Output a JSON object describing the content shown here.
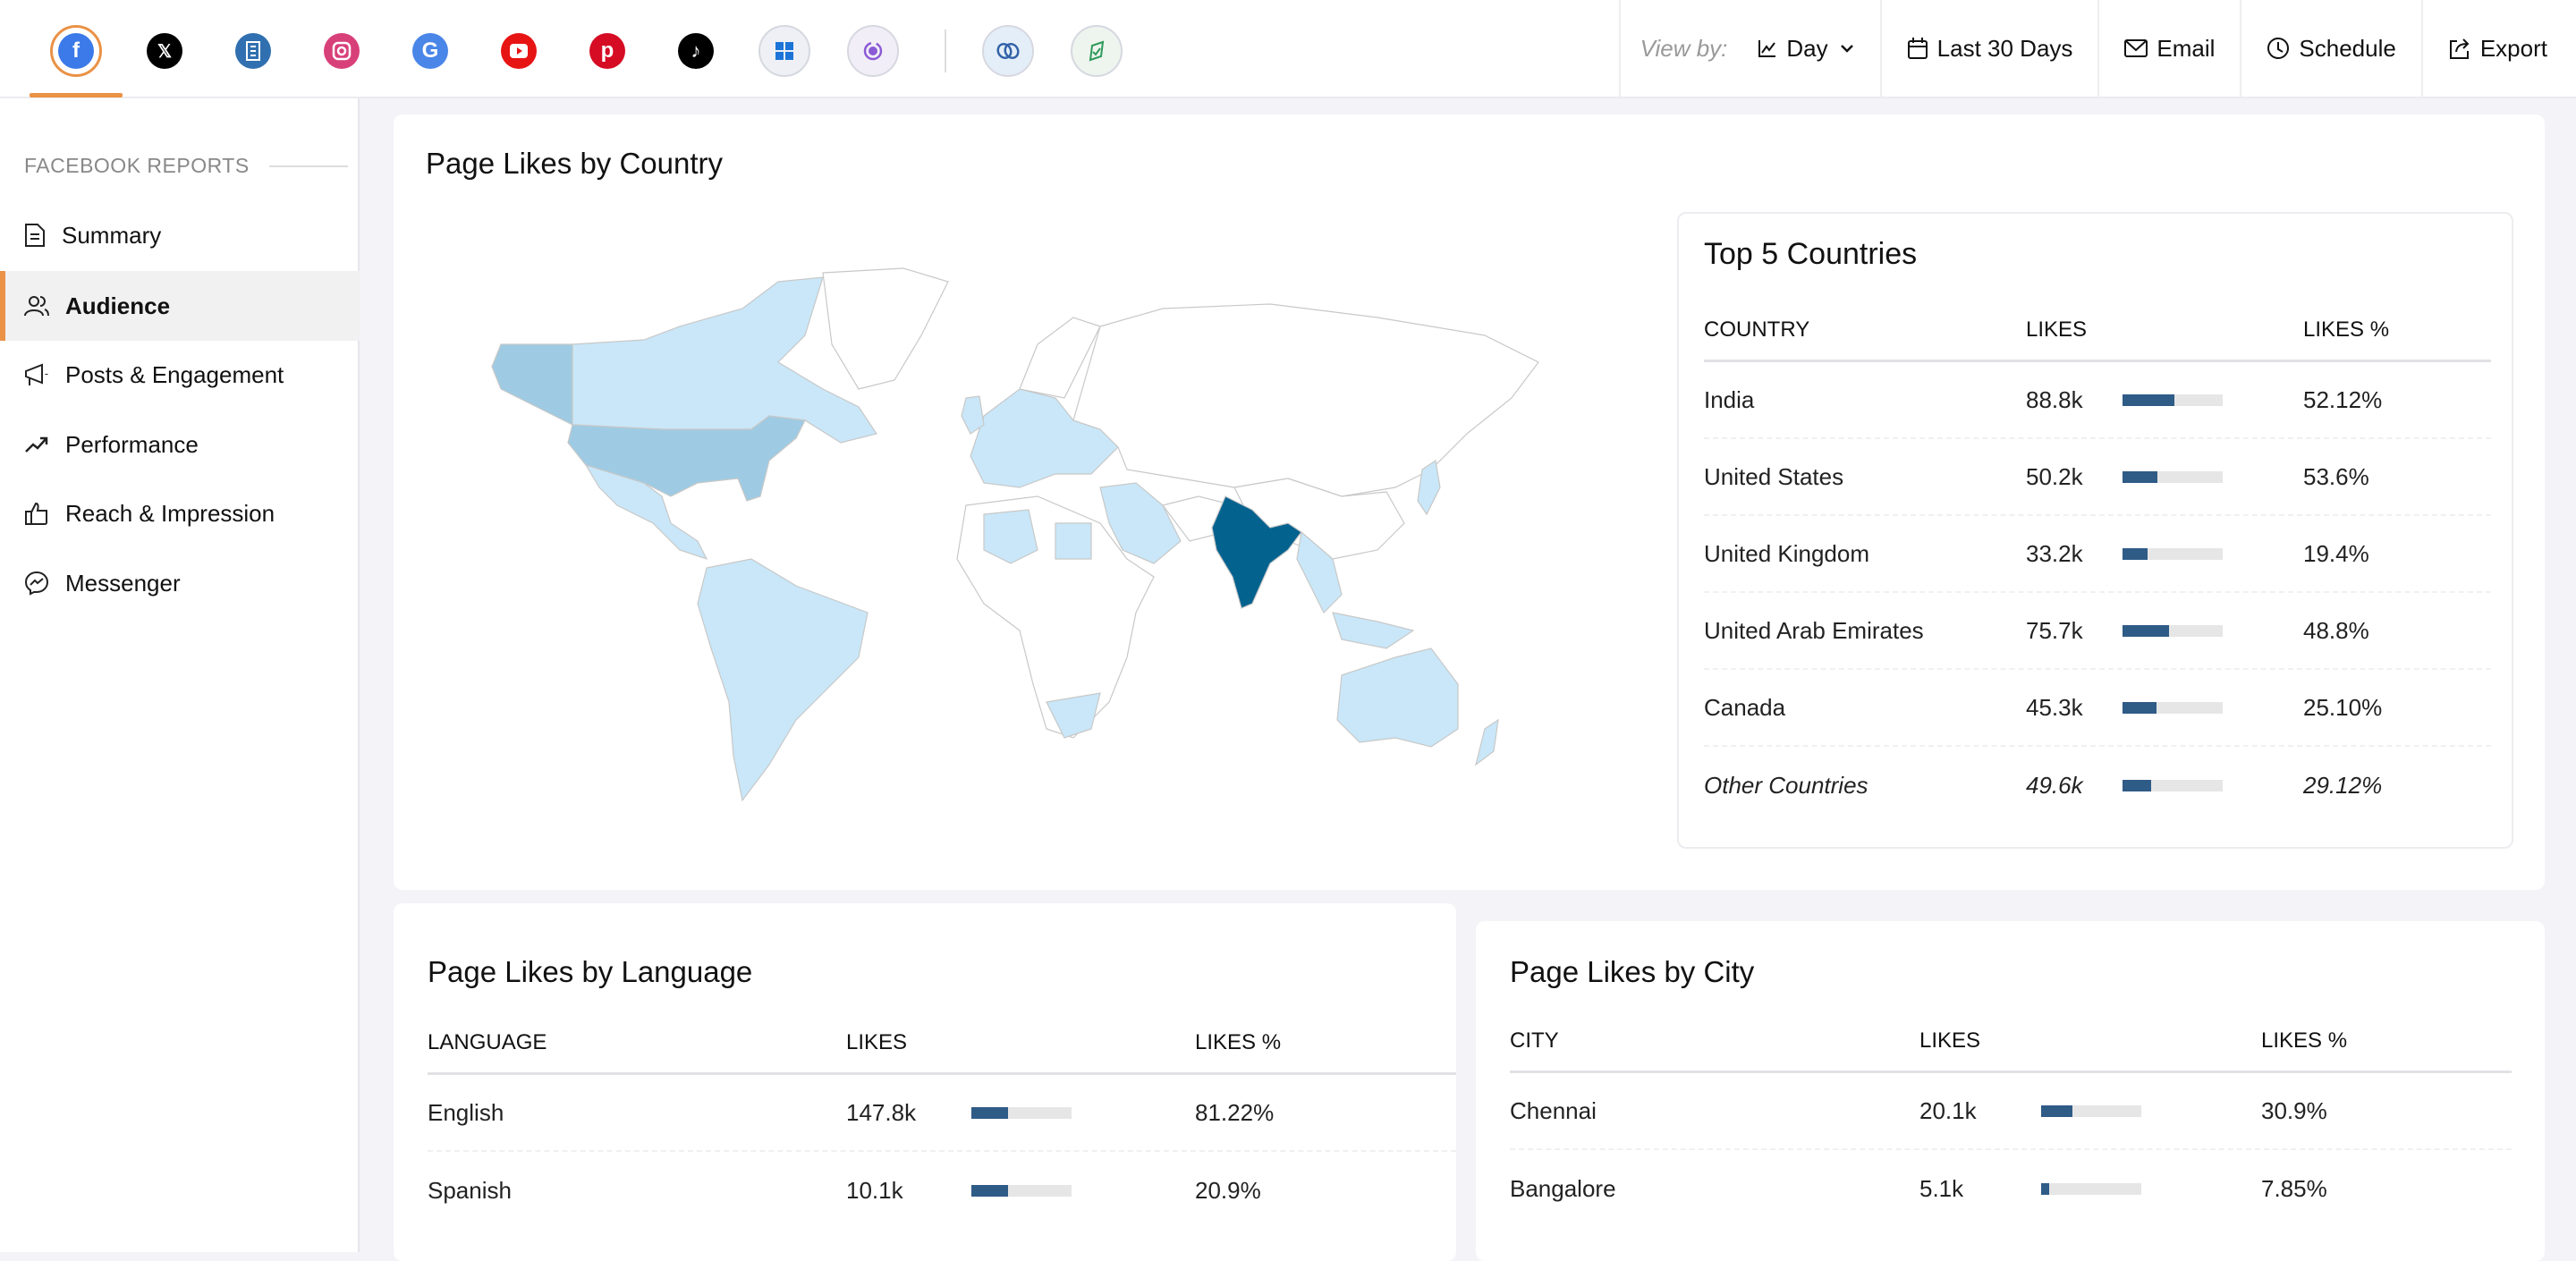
{
  "header": {
    "networks": [
      {
        "name": "facebook",
        "active": true
      },
      {
        "name": "x"
      },
      {
        "name": "linkedin-pages"
      },
      {
        "name": "instagram"
      },
      {
        "name": "google-business"
      },
      {
        "name": "youtube"
      },
      {
        "name": "pinterest"
      },
      {
        "name": "tiktok"
      },
      {
        "name": "custom-dashboard"
      },
      {
        "name": "scheduler"
      },
      {
        "name": "zoho-integration"
      },
      {
        "name": "approval"
      }
    ],
    "view_by_label": "View by:",
    "view_by_value": "Day",
    "date_range": "Last 30 Days",
    "email_label": "Email",
    "schedule_label": "Schedule",
    "export_label": "Export"
  },
  "sidebar": {
    "heading": "FACEBOOK REPORTS",
    "items": [
      {
        "label": "Summary",
        "icon": "document-icon"
      },
      {
        "label": "Audience",
        "icon": "users-icon",
        "active": true
      },
      {
        "label": "Posts & Engagement",
        "icon": "megaphone-icon"
      },
      {
        "label": "Performance",
        "icon": "trend-icon"
      },
      {
        "label": "Reach & Impression",
        "icon": "thumbs-up-icon"
      },
      {
        "label": "Messenger",
        "icon": "messenger-icon"
      }
    ]
  },
  "colors": {
    "accent": "#ea9246",
    "bar": "#2f5b87",
    "map_high": "#04628f",
    "map_mid": "#9ecbe3",
    "map_low": "#c9e7f8"
  },
  "country_card": {
    "title": "Page Likes by Country",
    "top5": {
      "title": "Top 5 Countries",
      "headers": [
        "COUNTRY",
        "LIKES",
        "LIKES %"
      ],
      "rows": [
        {
          "name": "India",
          "likes": "88.8k",
          "pct": "52.12%",
          "bar": 0.52
        },
        {
          "name": "United States",
          "likes": "50.2k",
          "pct": "53.6%",
          "bar": 0.35
        },
        {
          "name": "United Kingdom",
          "likes": "33.2k",
          "pct": "19.4%",
          "bar": 0.25
        },
        {
          "name": "United Arab Emirates",
          "likes": "75.7k",
          "pct": "48.8%",
          "bar": 0.46
        },
        {
          "name": "Canada",
          "likes": "45.3k",
          "pct": "25.10%",
          "bar": 0.34
        },
        {
          "name": "Other Countries",
          "likes": "49.6k",
          "pct": "29.12%",
          "bar": 0.29,
          "other": true
        }
      ]
    }
  },
  "language_card": {
    "title": "Page Likes by Language",
    "headers": [
      "LANGUAGE",
      "LIKES",
      "LIKES %"
    ],
    "rows": [
      {
        "name": "English",
        "likes": "147.8k",
        "pct": "81.22%",
        "bar": 0.37
      },
      {
        "name": "Spanish",
        "likes": "10.1k",
        "pct": "20.9%",
        "bar": 0.37
      }
    ]
  },
  "city_card": {
    "title": "Page Likes by City",
    "headers": [
      "CITY",
      "LIKES",
      "LIKES %"
    ],
    "rows": [
      {
        "name": "Chennai",
        "likes": "20.1k",
        "pct": "30.9%",
        "bar": 0.31
      },
      {
        "name": "Bangalore",
        "likes": "5.1k",
        "pct": "7.85%",
        "bar": 0.08
      }
    ]
  }
}
